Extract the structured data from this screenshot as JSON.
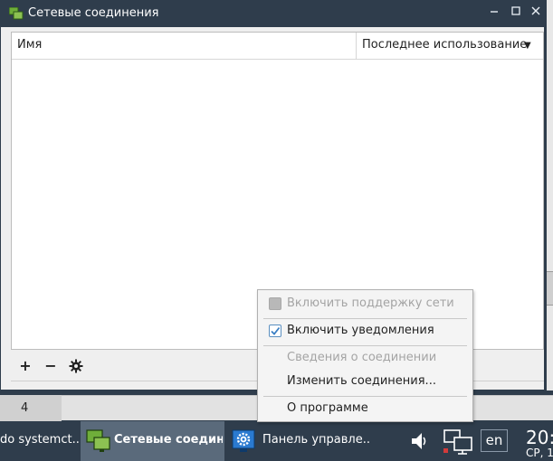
{
  "window": {
    "title": "Сетевые соединения",
    "title_icon": "network-connections-icon",
    "controls": [
      "minimize",
      "maximize",
      "close"
    ]
  },
  "list": {
    "columns": [
      "Имя",
      "Последнее использование"
    ],
    "sort_indicator": "▼",
    "rows": []
  },
  "toolbar": {
    "add_label": "+",
    "remove_label": "−",
    "settings_icon": "gear-icon"
  },
  "workspace": {
    "number": "4"
  },
  "context_menu": {
    "items": [
      {
        "label": "Включить поддержку сети",
        "checked": false,
        "enabled": false,
        "checkbox": true
      },
      {
        "label": "Включить уведомления",
        "checked": true,
        "enabled": true,
        "checkbox": true
      },
      {
        "label": "Сведения о соединении",
        "enabled": false,
        "checkbox": false
      },
      {
        "label": "Изменить соединения...",
        "enabled": true,
        "checkbox": false
      },
      {
        "label": "О программе",
        "enabled": true,
        "checkbox": false
      }
    ]
  },
  "taskbar": {
    "tasks": [
      {
        "label": "do systemct...",
        "active": false
      },
      {
        "label": "Сетевые соединения",
        "active": true,
        "icon": "network-connections-icon"
      },
      {
        "label": "Панель управле...",
        "active": false,
        "icon": "control-panel-icon"
      }
    ],
    "tray": {
      "volume_icon": "speaker-icon",
      "network_icon": "network-monitor-icon",
      "language": "en",
      "time": "20:",
      "date": "СР, 1"
    }
  },
  "colors": {
    "titlebar": "#2f3d4c",
    "taskbar": "#2f3d4c",
    "active_task": "#5a6a7b",
    "checkbox_accent": "#3a7fc4"
  }
}
